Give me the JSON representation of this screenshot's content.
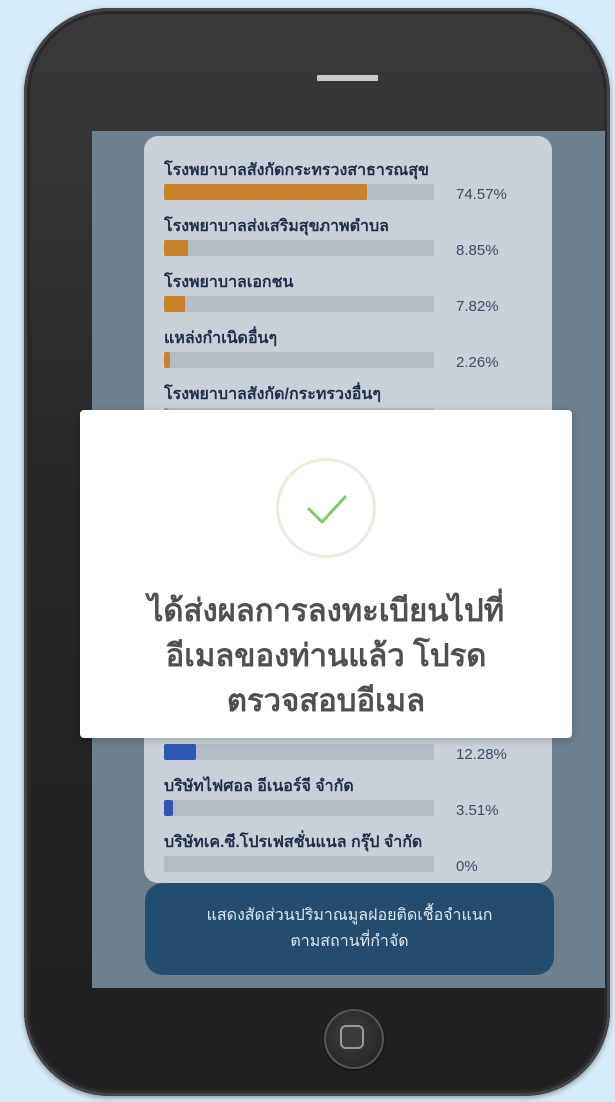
{
  "colors": {
    "background": "#d7ecfa",
    "orange_bar": "#c8822b",
    "blue_bar": "#2f56b5",
    "check_green": "#7ec96c",
    "button": "#244c6c"
  },
  "rows": [
    {
      "label": "โรงพยาบาลสังกัดกระทรวงสาธารณสุข",
      "percent": "74.57%",
      "fill_fraction": 0.75,
      "color": "#c8822b"
    },
    {
      "label": "โรงพยาบาลส่งเสริมสุขภาพตำบล",
      "percent": "8.85%",
      "fill_fraction": 0.089,
      "color": "#c8822b"
    },
    {
      "label": "โรงพยาบาลเอกชน",
      "percent": "7.82%",
      "fill_fraction": 0.078,
      "color": "#c8822b"
    },
    {
      "label": "แหล่งกำเนิดอื่นๆ",
      "percent": "2.26%",
      "fill_fraction": 0.023,
      "color": "#c8822b"
    },
    {
      "label": "โรงพยาบาลสังกัด/กระทรวงอื่นๆ",
      "percent": "",
      "fill_fraction": 0.01,
      "color": "#c8822b"
    }
  ],
  "lower_rows": [
    {
      "label": "",
      "percent": "12.28%",
      "fill_fraction": 0.12,
      "color": "#2f56b5"
    },
    {
      "label": "บริษัทไฟศอล อีเนอร์จี จำกัด",
      "percent": "3.51%",
      "fill_fraction": 0.035,
      "color": "#2f56b5"
    },
    {
      "label": "บริษัทเค.ซี.โปรเฟสชั่นแนล กรุ๊ป จำกัด",
      "percent": "0%",
      "fill_fraction": 0,
      "color": "#2f56b5"
    }
  ],
  "bottom_button": {
    "line1": "แสดงสัดส่วนปริมาณมูลฝอยติดเชื้อจำแนก",
    "line2": "ตามสถานที่กำจัด"
  },
  "modal": {
    "icon": "check-circle-icon",
    "line1": "ได้ส่งผลการลงทะเบียนไปที่",
    "line2": "อีเมลของท่านแล้ว โปรด",
    "line3": "ตรวจสอบอีเมล"
  }
}
